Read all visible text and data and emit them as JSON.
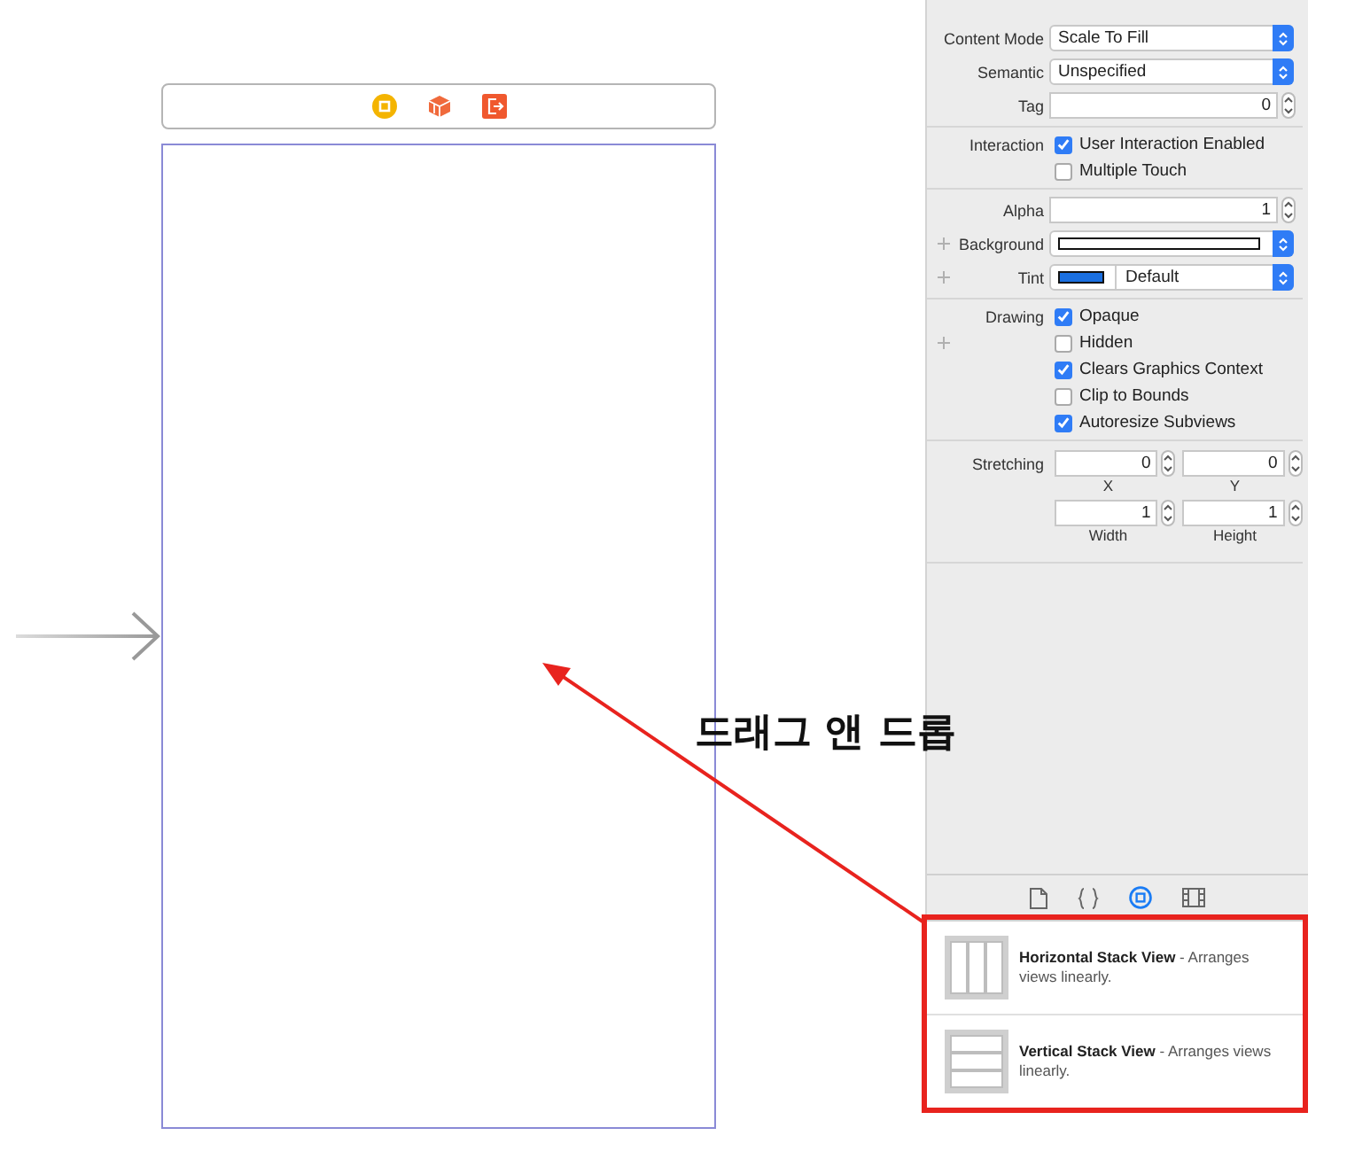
{
  "inspector": {
    "sections": [
      {
        "rows": [
          {
            "kind": "popup",
            "label": "Content Mode",
            "value": "Scale To Fill",
            "variable": false
          },
          {
            "kind": "popup",
            "label": "Semantic",
            "value": "Unspecified",
            "variable": false
          },
          {
            "kind": "stepper",
            "label": "Tag",
            "value": "0",
            "variable": false
          }
        ]
      },
      {
        "rows": [
          {
            "kind": "checks",
            "label": "Interaction",
            "items": [
              {
                "label": "User Interaction Enabled",
                "checked": true,
                "variable": false
              },
              {
                "label": "Multiple Touch",
                "checked": false,
                "variable": false
              }
            ]
          }
        ]
      },
      {
        "rows": [
          {
            "kind": "stepper",
            "label": "Alpha",
            "value": "1",
            "variable": false
          },
          {
            "kind": "color",
            "label": "Background",
            "color": "#ffffff",
            "variable": true
          },
          {
            "kind": "color",
            "label": "Tint",
            "color": "#1a6fe0",
            "value": "Default",
            "variable": true
          }
        ]
      },
      {
        "rows": [
          {
            "kind": "checks",
            "label": "Drawing",
            "items": [
              {
                "label": "Opaque",
                "checked": true,
                "variable": false
              },
              {
                "label": "Hidden",
                "checked": false,
                "variable": true
              },
              {
                "label": "Clears Graphics Context",
                "checked": true,
                "variable": false
              },
              {
                "label": "Clip to Bounds",
                "checked": false,
                "variable": false
              },
              {
                "label": "Autoresize Subviews",
                "checked": true,
                "variable": false
              }
            ]
          }
        ]
      },
      {
        "rows": [
          {
            "kind": "grid",
            "label": "Stretching",
            "fields": [
              {
                "value": "0",
                "caption": "X"
              },
              {
                "value": "0",
                "caption": "Y"
              },
              {
                "value": "1",
                "caption": "Width"
              },
              {
                "value": "1",
                "caption": "Height"
              }
            ]
          }
        ]
      }
    ]
  },
  "library": {
    "tabs": [
      {
        "kind": "file",
        "selected": false
      },
      {
        "kind": "code",
        "selected": false
      },
      {
        "kind": "object",
        "selected": true
      },
      {
        "kind": "media",
        "selected": false
      }
    ],
    "items": [
      {
        "kind": "horizontal",
        "text": "**Horizontal Stack View** - Arranges views linearly."
      },
      {
        "kind": "vertical",
        "text": "**Vertical Stack View** - Arranges views linearly."
      }
    ]
  },
  "annotation": {
    "label": "드래그 앤 드롭"
  }
}
